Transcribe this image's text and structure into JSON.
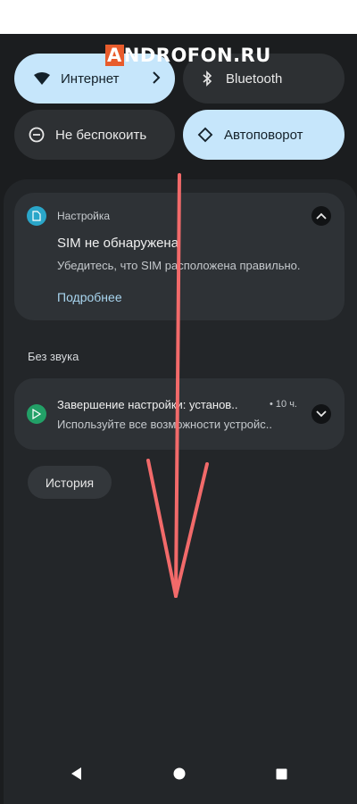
{
  "watermark": {
    "text": "NDROFON.RU",
    "badge": "A"
  },
  "quick_settings": {
    "internet": {
      "label": "Интернет",
      "state": "on"
    },
    "bluetooth": {
      "label": "Bluetooth",
      "state": "off"
    },
    "dnd": {
      "label": "Не беспокоить",
      "state": "off"
    },
    "autorotate": {
      "label": "Автоповорот",
      "state": "on"
    }
  },
  "notifications": {
    "sim": {
      "app_name": "Настройка",
      "title": "SIM не обнаружена",
      "text": "Убедитесь, что SIM расположена правильно.",
      "action": "Подробнее"
    },
    "silent_header": "Без звука",
    "setup": {
      "title": "Завершение настройки: установ..",
      "time": "• 10 ч.",
      "text": "Используйте все возможности устройс.."
    }
  },
  "history_button": "История",
  "colors": {
    "tile_on": "#c6e6fb",
    "tile_off": "#2d3033",
    "panel": "#232629",
    "card": "#2e3236",
    "settings_icon": "#2aa6c9",
    "play_icon": "#22a067",
    "arrow": "#f26a6a",
    "link": "#a9d6f0"
  },
  "icons": {
    "internet": "wifi-icon",
    "bluetooth": "bluetooth-icon",
    "dnd": "do-not-disturb-icon",
    "autorotate": "rotate-icon",
    "sim_app": "sim-settings-icon",
    "setup_app": "play-store-icon",
    "nav_back": "back-triangle-icon",
    "nav_home": "home-circle-icon",
    "nav_recents": "recents-square-icon"
  }
}
